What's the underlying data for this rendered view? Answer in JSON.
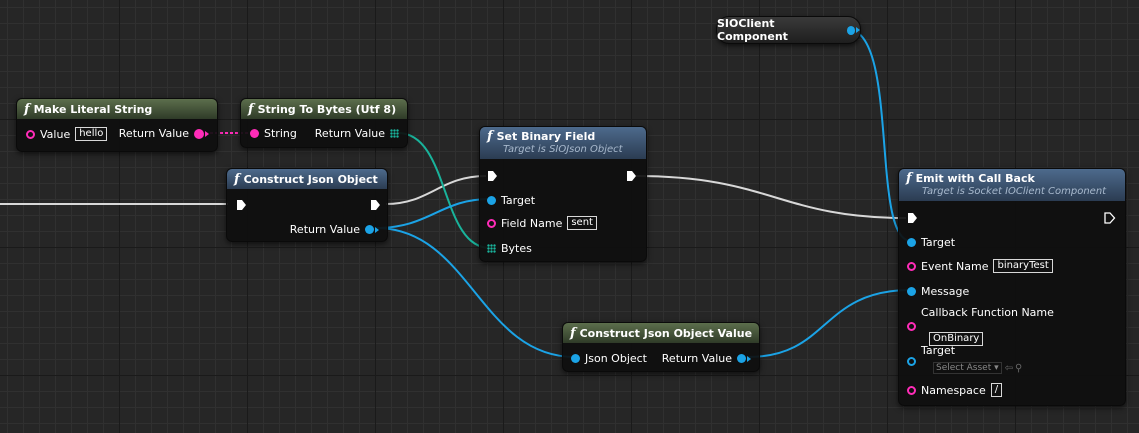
{
  "nodes": {
    "make_literal_string": {
      "title": "Make Literal String",
      "value_label": "Value",
      "value": "hello",
      "return_label": "Return Value"
    },
    "string_to_bytes": {
      "title": "String To Bytes (Utf 8)",
      "input_label": "String",
      "return_label": "Return Value"
    },
    "construct_json_object": {
      "title": "Construct Json Object",
      "return_label": "Return Value"
    },
    "set_binary_field": {
      "title": "Set Binary Field",
      "subtitle": "Target is SIOJson Object",
      "target_label": "Target",
      "field_name_label": "Field Name",
      "field_name_value": "sent",
      "bytes_label": "Bytes"
    },
    "sioclient_component": {
      "title": "SIOClient Component"
    },
    "construct_json_object_value": {
      "title": "Construct Json Object Value",
      "input_label": "Json Object",
      "return_label": "Return Value"
    },
    "emit_with_call_back": {
      "title": "Emit with Call Back",
      "subtitle": "Target is Socket IOClient Component",
      "target_label": "Target",
      "event_name_label": "Event Name",
      "event_name_value": "binaryTest",
      "message_label": "Message",
      "callback_label": "Callback Function Name",
      "callback_value": "OnBinary",
      "target2_label": "Target",
      "select_asset": "Select Asset",
      "namespace_label": "Namespace",
      "namespace_value": "/"
    }
  },
  "colors": {
    "exec_wire": "#d8d8d8",
    "string_pin": "#ff2cb8",
    "object_pin": "#1ba3e6",
    "byte_array_pin": "#19b39b"
  }
}
